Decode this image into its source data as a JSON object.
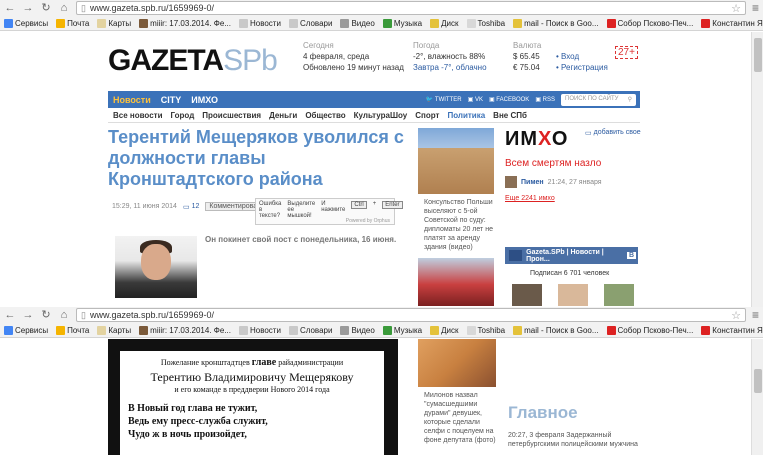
{
  "browser": {
    "url": "www.gazeta.spb.ru/1659969-0/",
    "bookmarks": [
      {
        "label": "Сервисы",
        "color": "#4285f4"
      },
      {
        "label": "Почта",
        "color": "#f5b400"
      },
      {
        "label": "Карты",
        "color": "#e3d3a0"
      },
      {
        "label": "miiir: 17.03.2014. Фе...",
        "color": "#7b5a3a"
      },
      {
        "label": "Новости",
        "color": "#c9c9c9"
      },
      {
        "label": "Словари",
        "color": "#c9c9c9"
      },
      {
        "label": "Видео",
        "color": "#9a9a9a"
      },
      {
        "label": "Музыка",
        "color": "#3a9a3a"
      },
      {
        "label": "Диск",
        "color": "#e4c23a"
      },
      {
        "label": "Toshiba",
        "color": "#d8d8d8"
      },
      {
        "label": "mail - Поиск в Goo...",
        "color": "#e4c23a"
      },
      {
        "label": "Собор Псково-Печ...",
        "color": "#d22"
      },
      {
        "label": "Константин Яросл...",
        "color": "#d22"
      }
    ]
  },
  "site": {
    "logo_main": "GAZETA",
    "logo_spb": "SPb",
    "today_label": "Сегодня",
    "today_date": "4 февраля, среда",
    "today_updated": "Обновлено 19 минут назад",
    "weather_label": "Погода",
    "weather_now": "-2°, влажность 88%",
    "weather_tomorrow": "Завтра -7°, облачно",
    "currency_label": "Валюта",
    "usd": "$ 65.45",
    "eur": "€ 75.04",
    "login": "• Вход",
    "register": "• Регистрация",
    "age": "27+"
  },
  "nav": {
    "items": [
      "Новости",
      "CITY",
      "ИМХО"
    ],
    "social": [
      "TWITTER",
      "VK",
      "FACEBOOK",
      "RSS"
    ],
    "search_placeholder": "ПОИСК ПО САЙТУ"
  },
  "subnav": [
    "Все новости",
    "Город",
    "Происшествия",
    "Деньги",
    "Общество",
    "КультураШоу",
    "Спорт",
    "Политика",
    "Вне СПб"
  ],
  "article": {
    "headline": "Терентий Мещеряков уволился с должности главы Кронштадтского района",
    "date": "15:29, 11 июня 2014",
    "comments_count": "12",
    "comment_btn": "Комментировать",
    "lead": "Он покинет свой пост с понедельника, 16 июня.",
    "err_q": "Ошибка в тексте?",
    "err_hint": "Выделите ее мышкой!",
    "err_press": "И нажмите",
    "key_ctrl": "Ctrl",
    "key_plus": "+",
    "key_enter": "Enter",
    "powered": "Powered by Orphus"
  },
  "middle": {
    "caption1": "Консульство Польши выселяют с 5-ой Советской по суду: дипломаты 20 лет не платят за аренду здания (видео)",
    "caption2": "Милонов назвал \"сумасшедшими дурами\" девушек, которые сделали селфи с поцелуем на фоне депутата (фото)"
  },
  "imho": {
    "logo_a": "ИМ",
    "logo_x": "Х",
    "logo_o": "О",
    "add_fav": "добавить свое",
    "title": "Всем смертям назло",
    "author": "Пимен",
    "time": "21:24, 27 января",
    "more": "Еще 2241 имхо"
  },
  "vk": {
    "title": "Gazeta.SPb | Новости | Прон...",
    "badge": "В",
    "subs": "Подписан 6 701 человек"
  },
  "card": {
    "line1": "Пожелание кронштадтцев",
    "line1_b": "главе",
    "line1_c": "райадминистрации",
    "name": "Терентию Владимировичу Мещерякову",
    "line3": "и его команде в преддверии Нового 2014 года",
    "poem1": "В Новый год  глава не тужит,",
    "poem2": "Ведь ему пресс-служба служит,",
    "poem3": "Чудо ж в ночь произойдет,"
  },
  "glavnoe": {
    "title": "Главное",
    "item": "20:27, 3 февраля Задержанный петербургскими полицейскими мужчина"
  }
}
